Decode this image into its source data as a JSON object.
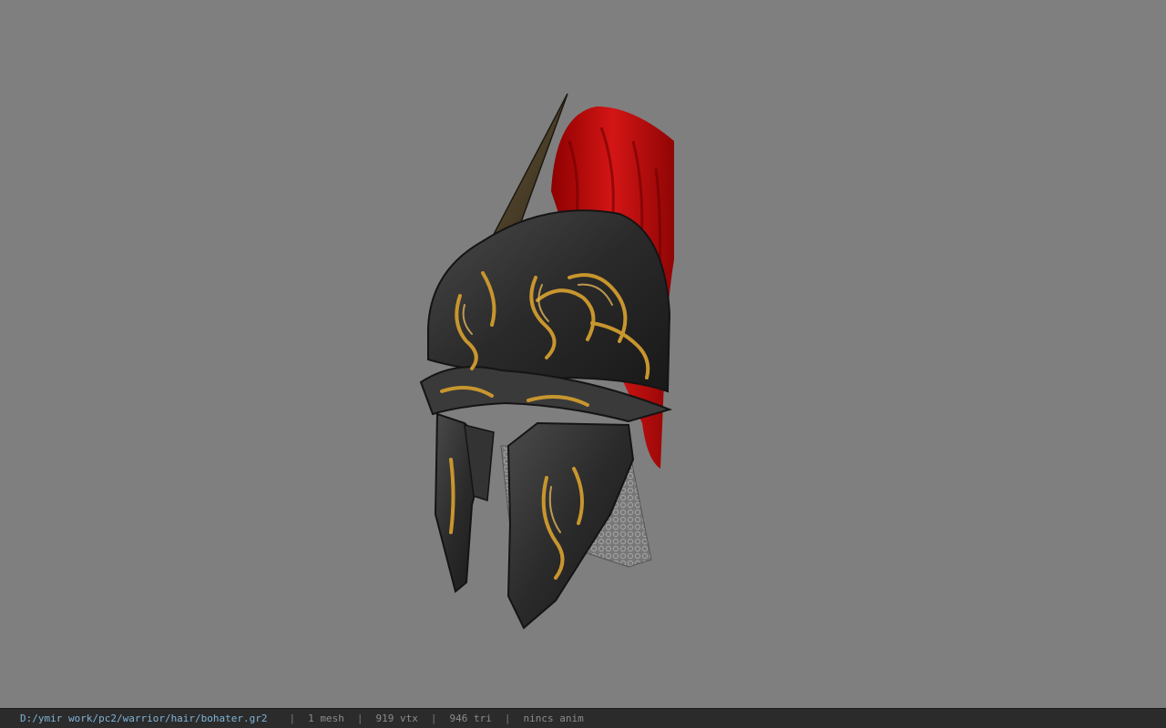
{
  "viewer": {
    "background_color": "#7f7f7f",
    "model_icon": "helmet-model"
  },
  "status": {
    "file_path": "D:/ymir work/pc2/warrior/hair/bohater.gr2",
    "separator": "|",
    "mesh_count": "1 mesh",
    "vertex_count": "919 vtx",
    "triangle_count": "946 tri",
    "animation": "nincs anim"
  },
  "colors": {
    "plume": "#c41010",
    "helmet_metal": "#2e2e2e",
    "gold_trim": "#c8962e",
    "chainmail": "#8a8a8a",
    "path_text": "#7fb3d8"
  }
}
